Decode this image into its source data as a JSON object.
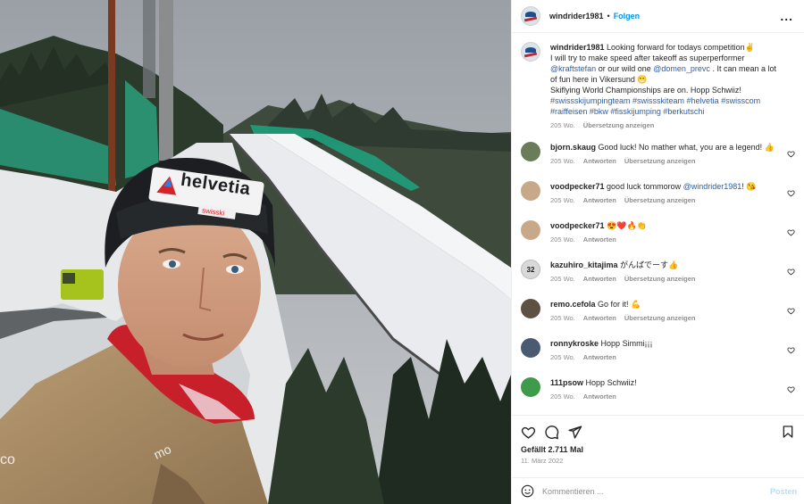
{
  "post": {
    "username": "windrider1981",
    "separator": "•",
    "follow_label": "Folgen",
    "more_label": "...",
    "caption": {
      "username": "windrider1981",
      "line1": "Looking forward for todays competition✌️",
      "line2a": "I will try to make speed after takeoff as superperformer",
      "mention1": "@kraftstefan",
      "line3a": "or our wild one",
      "mention2": "@domen_prevc",
      "line3b": ". It can mean a lot of fun here in Vikersund 😁",
      "line4": "Skiflying World Championships are on. Hopp Schwiiz!",
      "hashtags": "#swissskijumpingteam #swissskiteam #helvetia #swisscom #raiffeisen #bkw #fisskijumping #berkutschi",
      "time": "205 Wo.",
      "translate": "Übersetzung anzeigen"
    },
    "likes": "Gefällt 2.711 Mal",
    "date": "11. März 2022",
    "add_comment_placeholder": "Kommentieren ...",
    "post_label": "Posten"
  },
  "comments": [
    {
      "user": "bjorn.skaug",
      "text": "Good luck! No mather what, you are a legend! 👍",
      "time": "205 Wo.",
      "reply": "Antworten",
      "translate": "Übersetzung anzeigen",
      "avatar_color": "#6b7c5a"
    },
    {
      "user": "voodpecker71",
      "text_a": "good luck tommorow",
      "mention": "@windrider1981",
      "text_b": "! 😘",
      "time": "205 Wo.",
      "reply": "Antworten",
      "translate": "Übersetzung anzeigen",
      "avatar_color": "#c7a98a"
    },
    {
      "user": "voodpecker71",
      "text": "😍❤️🔥👏",
      "time": "205 Wo.",
      "reply": "Antworten",
      "avatar_color": "#c7a98a"
    },
    {
      "user": "kazuhiro_kitajima",
      "text": "がんばでーす👍",
      "time": "205 Wo.",
      "reply": "Antworten",
      "translate": "Übersetzung anzeigen",
      "avatar_color": "#d9d9d9",
      "avatar_text": "32"
    },
    {
      "user": "remo.cefola",
      "text": "Go for it! 💪",
      "time": "205 Wo.",
      "reply": "Antworten",
      "translate": "Übersetzung anzeigen",
      "avatar_color": "#5e5143"
    },
    {
      "user": "ronnykroske",
      "text": "Hopp Simmi¡¡¡",
      "time": "205 Wo.",
      "reply": "Antworten",
      "avatar_color": "#4a5a70"
    },
    {
      "user": "111psow",
      "text": "Hopp Schwiiz!",
      "time": "205 Wo.",
      "reply": "Antworten",
      "avatar_color": "#3f9a4a"
    }
  ],
  "photo": {
    "hat_brand": "helvetia",
    "hat_label": "swisski"
  }
}
